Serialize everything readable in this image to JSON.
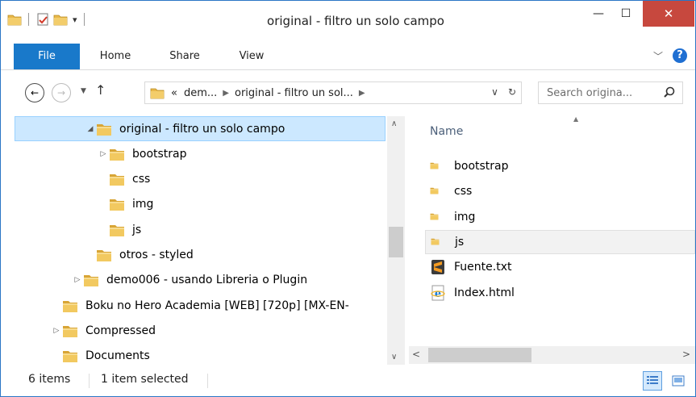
{
  "window": {
    "title": "original - filtro un solo campo",
    "minimize": "—",
    "maximize": "☐",
    "close": "✕"
  },
  "ribbon": {
    "tabs": [
      "File",
      "Home",
      "Share",
      "View"
    ],
    "help": "?"
  },
  "address": {
    "overflow": "«",
    "crumbs": [
      "dem...",
      "original - filtro un sol..."
    ],
    "search_placeholder": "Search origina..."
  },
  "tree": [
    {
      "label": "original - filtro un solo campo",
      "indent": 3,
      "expand": "open",
      "selected": true
    },
    {
      "label": "bootstrap",
      "indent": 4,
      "expand": "closed"
    },
    {
      "label": "css",
      "indent": 4,
      "expand": "none"
    },
    {
      "label": "img",
      "indent": 4,
      "expand": "none"
    },
    {
      "label": "js",
      "indent": 4,
      "expand": "none"
    },
    {
      "label": "otros - styled",
      "indent": 3,
      "expand": "none"
    },
    {
      "label": "demo006 - usando Libreria o Plugin",
      "indent": 2,
      "expand": "closed"
    },
    {
      "label": "Boku no Hero Academia [WEB] [720p] [MX-EN-",
      "indent": 1,
      "expand": "none"
    },
    {
      "label": "Compressed",
      "indent": 1,
      "expand": "closed"
    },
    {
      "label": "Documents",
      "indent": 1,
      "expand": "none"
    }
  ],
  "content": {
    "column_name": "Name",
    "items": [
      {
        "label": "bootstrap",
        "icon": "folder-icon"
      },
      {
        "label": "css",
        "icon": "folder-icon"
      },
      {
        "label": "img",
        "icon": "folder-icon"
      },
      {
        "label": "js",
        "icon": "folder-icon",
        "hover": true
      },
      {
        "label": "Fuente.txt",
        "icon": "sublime-text-file-icon"
      },
      {
        "label": "Index.html",
        "icon": "ie-html-file-icon"
      }
    ]
  },
  "status": {
    "count": "6 items",
    "selection": "1 item selected"
  },
  "colors": {
    "accent": "#1979ca",
    "selection_bg": "#cce8ff",
    "close_btn": "#c7483e",
    "folder": "#e8b84a"
  }
}
